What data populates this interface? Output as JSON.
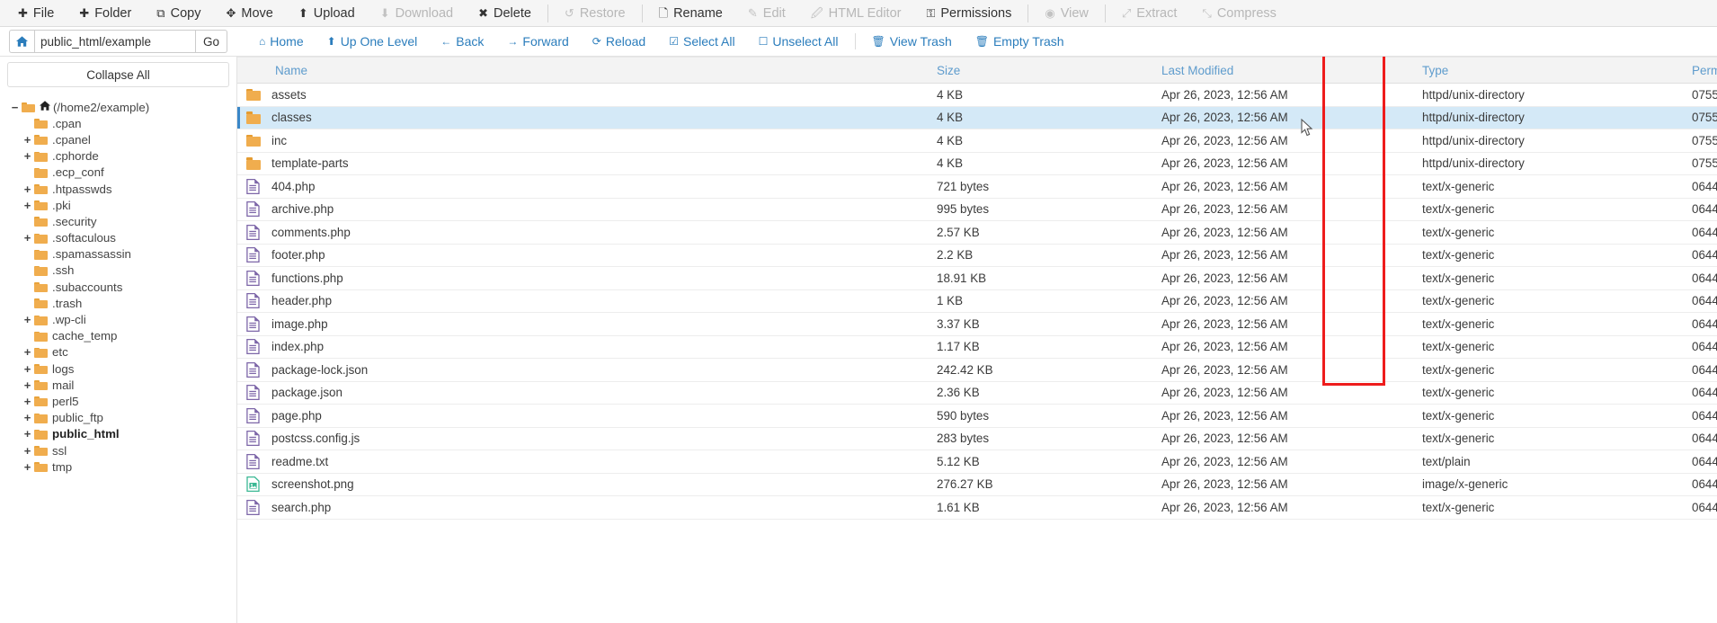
{
  "toolbar": {
    "buttons": [
      {
        "label": "File",
        "icon": "plus-icon",
        "glyph": "✚",
        "disabled": false
      },
      {
        "label": "Folder",
        "icon": "plus-icon",
        "glyph": "✚",
        "disabled": false
      },
      {
        "label": "Copy",
        "icon": "copy-icon",
        "glyph": "⧉",
        "disabled": false
      },
      {
        "label": "Move",
        "icon": "move-icon",
        "glyph": "✥",
        "disabled": false
      },
      {
        "label": "Upload",
        "icon": "upload-icon",
        "glyph": "⬆",
        "disabled": false
      },
      {
        "label": "Download",
        "icon": "download-icon",
        "glyph": "⬇",
        "disabled": true
      },
      {
        "label": "Delete",
        "icon": "x-cross-icon",
        "glyph": "✖",
        "disabled": false
      },
      {
        "label": "Restore",
        "icon": "undo-arrow-icon",
        "glyph": "↺",
        "disabled": true
      },
      {
        "label": "Rename",
        "icon": "file-icon",
        "glyph": "🗋",
        "disabled": false
      },
      {
        "label": "Edit",
        "icon": "pencil-icon",
        "glyph": "✎",
        "disabled": true
      },
      {
        "label": "HTML Editor",
        "icon": "html-editor-icon",
        "glyph": "🖉",
        "disabled": true
      },
      {
        "label": "Permissions",
        "icon": "key-icon",
        "glyph": "⚿",
        "disabled": false
      },
      {
        "label": "View",
        "icon": "eye-icon",
        "glyph": "◉",
        "disabled": true
      },
      {
        "label": "Extract",
        "icon": "expand-icon",
        "glyph": "⤢",
        "disabled": true
      },
      {
        "label": "Compress",
        "icon": "compress-icon",
        "glyph": "⤡",
        "disabled": true
      }
    ],
    "separators_after": [
      "Delete",
      "Restore",
      "Permissions",
      "View"
    ]
  },
  "pathbar": {
    "home_icon": "home-icon",
    "value": "public_html/example",
    "placeholder": "public_html/example",
    "go_label": "Go"
  },
  "nav": {
    "links": [
      {
        "label": "Home",
        "icon": "home-icon",
        "glyph": "⌂"
      },
      {
        "label": "Up One Level",
        "icon": "up-arrow-icon",
        "glyph": "⬆"
      },
      {
        "label": "Back",
        "icon": "arrow-left-icon",
        "glyph": "←"
      },
      {
        "label": "Forward",
        "icon": "arrow-right-icon",
        "glyph": "→"
      },
      {
        "label": "Reload",
        "icon": "reload-icon",
        "glyph": "⟳"
      },
      {
        "label": "Select All",
        "icon": "checkbox-checked-icon",
        "glyph": "☑"
      },
      {
        "label": "Unselect All",
        "icon": "checkbox-empty-icon",
        "glyph": "☐"
      },
      {
        "label": "View Trash",
        "icon": "trash-icon",
        "glyph": "🗑"
      },
      {
        "label": "Empty Trash",
        "icon": "trash-icon",
        "glyph": "🗑"
      }
    ],
    "separator_after": "Unselect All"
  },
  "sidebar": {
    "collapse_label": "Collapse All",
    "tree": [
      {
        "label": "(/home2/example)",
        "expander": "−",
        "indent": 0,
        "home": true,
        "bold": false
      },
      {
        "label": ".cpan",
        "expander": "",
        "indent": 1,
        "home": false,
        "bold": false
      },
      {
        "label": ".cpanel",
        "expander": "+",
        "indent": 1,
        "home": false,
        "bold": false
      },
      {
        "label": ".cphorde",
        "expander": "+",
        "indent": 1,
        "home": false,
        "bold": false
      },
      {
        "label": ".ecp_conf",
        "expander": "",
        "indent": 1,
        "home": false,
        "bold": false
      },
      {
        "label": ".htpasswds",
        "expander": "+",
        "indent": 1,
        "home": false,
        "bold": false
      },
      {
        "label": ".pki",
        "expander": "+",
        "indent": 1,
        "home": false,
        "bold": false
      },
      {
        "label": ".security",
        "expander": "",
        "indent": 1,
        "home": false,
        "bold": false
      },
      {
        "label": ".softaculous",
        "expander": "+",
        "indent": 1,
        "home": false,
        "bold": false
      },
      {
        "label": ".spamassassin",
        "expander": "",
        "indent": 1,
        "home": false,
        "bold": false
      },
      {
        "label": ".ssh",
        "expander": "",
        "indent": 1,
        "home": false,
        "bold": false
      },
      {
        "label": ".subaccounts",
        "expander": "",
        "indent": 1,
        "home": false,
        "bold": false
      },
      {
        "label": ".trash",
        "expander": "",
        "indent": 1,
        "home": false,
        "bold": false
      },
      {
        "label": ".wp-cli",
        "expander": "+",
        "indent": 1,
        "home": false,
        "bold": false
      },
      {
        "label": "cache_temp",
        "expander": "",
        "indent": 1,
        "home": false,
        "bold": false
      },
      {
        "label": "etc",
        "expander": "+",
        "indent": 1,
        "home": false,
        "bold": false
      },
      {
        "label": "logs",
        "expander": "+",
        "indent": 1,
        "home": false,
        "bold": false
      },
      {
        "label": "mail",
        "expander": "+",
        "indent": 1,
        "home": false,
        "bold": false
      },
      {
        "label": "perl5",
        "expander": "+",
        "indent": 1,
        "home": false,
        "bold": false
      },
      {
        "label": "public_ftp",
        "expander": "+",
        "indent": 1,
        "home": false,
        "bold": false
      },
      {
        "label": "public_html",
        "expander": "+",
        "indent": 1,
        "home": false,
        "bold": true
      },
      {
        "label": "ssl",
        "expander": "+",
        "indent": 1,
        "home": false,
        "bold": false
      },
      {
        "label": "tmp",
        "expander": "+",
        "indent": 1,
        "home": false,
        "bold": false
      }
    ]
  },
  "table": {
    "columns": [
      {
        "key": "name",
        "label": "Name"
      },
      {
        "key": "size",
        "label": "Size"
      },
      {
        "key": "modified",
        "label": "Last Modified"
      },
      {
        "key": "type",
        "label": "Type"
      },
      {
        "key": "permissions",
        "label": "Permissions"
      }
    ],
    "rows": [
      {
        "name": "assets",
        "icon": "folder-icon",
        "size": "4 KB",
        "modified": "Apr 26, 2023, 12:56 AM",
        "type": "httpd/unix-directory",
        "permissions": "0755",
        "selected": false
      },
      {
        "name": "classes",
        "icon": "folder-icon",
        "size": "4 KB",
        "modified": "Apr 26, 2023, 12:56 AM",
        "type": "httpd/unix-directory",
        "permissions": "0755",
        "selected": true
      },
      {
        "name": "inc",
        "icon": "folder-icon",
        "size": "4 KB",
        "modified": "Apr 26, 2023, 12:56 AM",
        "type": "httpd/unix-directory",
        "permissions": "0755",
        "selected": false
      },
      {
        "name": "template-parts",
        "icon": "folder-icon",
        "size": "4 KB",
        "modified": "Apr 26, 2023, 12:56 AM",
        "type": "httpd/unix-directory",
        "permissions": "0755",
        "selected": false
      },
      {
        "name": "404.php",
        "icon": "document-icon",
        "size": "721 bytes",
        "modified": "Apr 26, 2023, 12:56 AM",
        "type": "text/x-generic",
        "permissions": "0644",
        "selected": false
      },
      {
        "name": "archive.php",
        "icon": "document-icon",
        "size": "995 bytes",
        "modified": "Apr 26, 2023, 12:56 AM",
        "type": "text/x-generic",
        "permissions": "0644",
        "selected": false
      },
      {
        "name": "comments.php",
        "icon": "document-icon",
        "size": "2.57 KB",
        "modified": "Apr 26, 2023, 12:56 AM",
        "type": "text/x-generic",
        "permissions": "0644",
        "selected": false
      },
      {
        "name": "footer.php",
        "icon": "document-icon",
        "size": "2.2 KB",
        "modified": "Apr 26, 2023, 12:56 AM",
        "type": "text/x-generic",
        "permissions": "0644",
        "selected": false
      },
      {
        "name": "functions.php",
        "icon": "document-icon",
        "size": "18.91 KB",
        "modified": "Apr 26, 2023, 12:56 AM",
        "type": "text/x-generic",
        "permissions": "0644",
        "selected": false
      },
      {
        "name": "header.php",
        "icon": "document-icon",
        "size": "1 KB",
        "modified": "Apr 26, 2023, 12:56 AM",
        "type": "text/x-generic",
        "permissions": "0644",
        "selected": false
      },
      {
        "name": "image.php",
        "icon": "document-icon",
        "size": "3.37 KB",
        "modified": "Apr 26, 2023, 12:56 AM",
        "type": "text/x-generic",
        "permissions": "0644",
        "selected": false
      },
      {
        "name": "index.php",
        "icon": "document-icon",
        "size": "1.17 KB",
        "modified": "Apr 26, 2023, 12:56 AM",
        "type": "text/x-generic",
        "permissions": "0644",
        "selected": false
      },
      {
        "name": "package-lock.json",
        "icon": "document-icon",
        "size": "242.42 KB",
        "modified": "Apr 26, 2023, 12:56 AM",
        "type": "text/x-generic",
        "permissions": "0644",
        "selected": false
      },
      {
        "name": "package.json",
        "icon": "document-icon",
        "size": "2.36 KB",
        "modified": "Apr 26, 2023, 12:56 AM",
        "type": "text/x-generic",
        "permissions": "0644",
        "selected": false
      },
      {
        "name": "page.php",
        "icon": "document-icon",
        "size": "590 bytes",
        "modified": "Apr 26, 2023, 12:56 AM",
        "type": "text/x-generic",
        "permissions": "0644",
        "selected": false
      },
      {
        "name": "postcss.config.js",
        "icon": "document-icon",
        "size": "283 bytes",
        "modified": "Apr 26, 2023, 12:56 AM",
        "type": "text/x-generic",
        "permissions": "0644",
        "selected": false
      },
      {
        "name": "readme.txt",
        "icon": "document-icon",
        "size": "5.12 KB",
        "modified": "Apr 26, 2023, 12:56 AM",
        "type": "text/plain",
        "permissions": "0644",
        "selected": false
      },
      {
        "name": "screenshot.png",
        "icon": "image-file-icon",
        "size": "276.27 KB",
        "modified": "Apr 26, 2023, 12:56 AM",
        "type": "image/x-generic",
        "permissions": "0644",
        "selected": false
      },
      {
        "name": "search.php",
        "icon": "document-icon",
        "size": "1.61 KB",
        "modified": "Apr 26, 2023, 12:56 AM",
        "type": "text/x-generic",
        "permissions": "0644",
        "selected": false
      }
    ]
  },
  "annotation": {
    "highlight_color": "#ee1c1c",
    "target_column": "Permissions"
  },
  "colors": {
    "link": "#2b7dbc",
    "header_text": "#5f9ccd",
    "selected_row": "#d4e9f7",
    "folder": "#f0ad4e",
    "doc_icon": "#7d66a8",
    "image_icon": "#3bb894"
  }
}
